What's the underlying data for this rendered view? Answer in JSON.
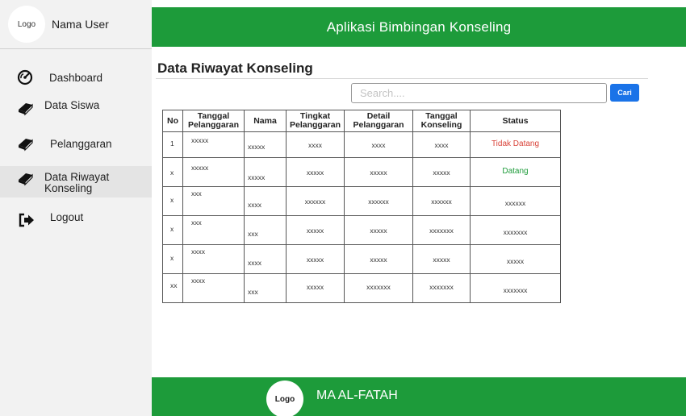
{
  "sidebar": {
    "logo": "Logo",
    "user_name": "Nama User",
    "items": [
      {
        "label": "Dashboard",
        "icon": "dashboard-gauge-icon"
      },
      {
        "label": "Data Siswa",
        "icon": "book-icon"
      },
      {
        "label": "Pelanggaran",
        "icon": "book-icon"
      },
      {
        "label": "Data Riwayat Konseling",
        "icon": "book-icon",
        "active": true
      },
      {
        "label": "Logout",
        "icon": "logout-icon"
      }
    ]
  },
  "header": {
    "title": "Aplikasi Bimbingan Konseling"
  },
  "main": {
    "title": "Data Riwayat Konseling",
    "search": {
      "placeholder": "Search....",
      "button": "Cari"
    },
    "table": {
      "headers": [
        "No",
        "Tanggal Pelanggaran",
        "Nama",
        "Tingkat Pelanggaran",
        "Detail Pelanggaran",
        "Tanggal Konseling",
        "Status"
      ],
      "rows": [
        [
          "1",
          "xxxxx",
          "xxxxx",
          "xxxx",
          "xxxx",
          "xxxx",
          "Tidak Datang"
        ],
        [
          "x",
          "xxxxx",
          "xxxxx",
          "xxxxx",
          "xxxxx",
          "xxxxx",
          "Datang"
        ],
        [
          "x",
          "xxx",
          "xxxx",
          "xxxxxx",
          "xxxxxx",
          "xxxxxx",
          "xxxxxx"
        ],
        [
          "x",
          "xxx",
          "xxx",
          "xxxxx",
          "xxxxx",
          "xxxxxxx",
          "xxxxxxx"
        ],
        [
          "x",
          "xxxx",
          "xxxx",
          "xxxxx",
          "xxxxx",
          "xxxxx",
          "xxxxx"
        ],
        [
          "xx",
          "xxxx",
          "xxx",
          "xxxxx",
          "xxxxxxx",
          "xxxxxxx",
          "xxxxxxx"
        ]
      ]
    }
  },
  "footer": {
    "logo": "Logo",
    "name": "MA AL-FATAH"
  },
  "colors": {
    "primary_green": "#1d9b3a",
    "button_blue": "#1a73e8",
    "status_absent": "#d9443a",
    "status_present": "#1d9b3a"
  }
}
